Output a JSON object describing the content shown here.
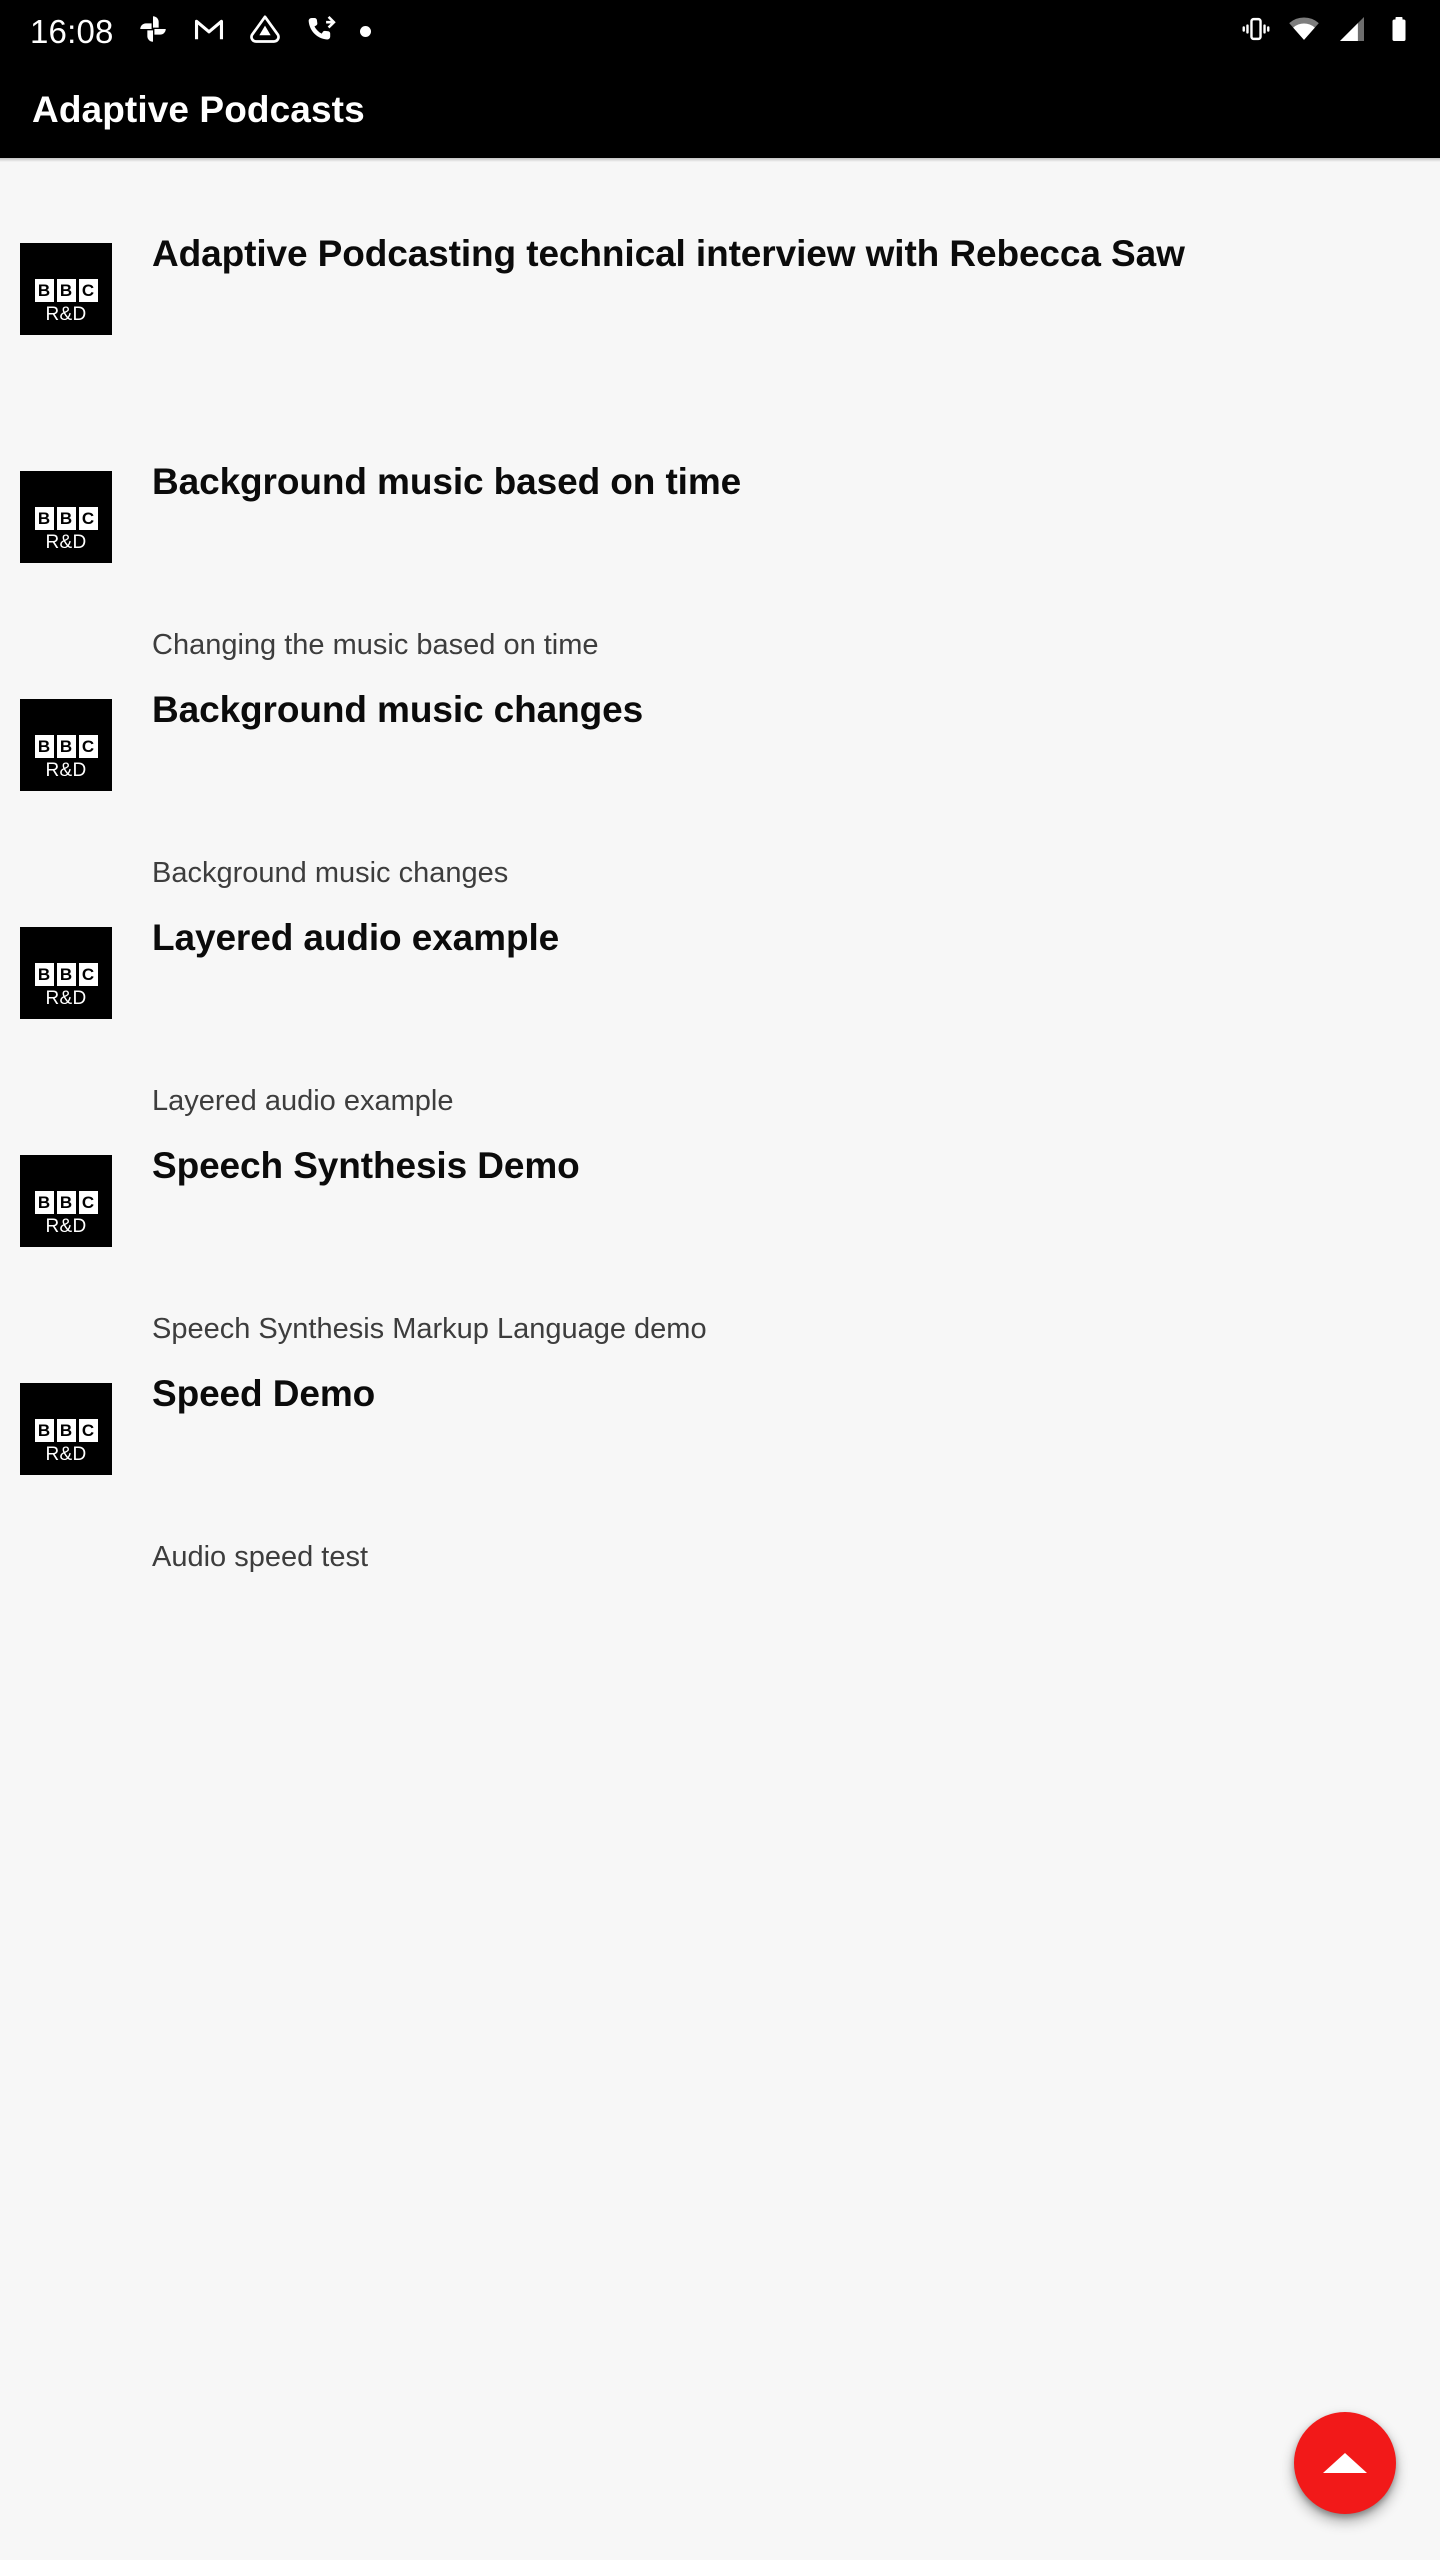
{
  "status_bar": {
    "time": "16:08",
    "left_icons": [
      "google-photos-icon",
      "gmail-icon",
      "drive-icon",
      "call-forward-icon",
      "dot-icon"
    ],
    "right_icons": [
      "vibrate-icon",
      "wifi-icon",
      "cellular-signal-icon",
      "battery-icon"
    ]
  },
  "app_bar": {
    "title": "Adaptive Podcasts"
  },
  "thumbnail": {
    "letters": [
      "B",
      "B",
      "C"
    ],
    "sub": "R&D"
  },
  "podcasts": [
    {
      "title": "Adaptive Podcasting technical interview with Rebecca Saw",
      "subtitle": ""
    },
    {
      "title": "Background music based on time",
      "subtitle": "Changing the music based on time"
    },
    {
      "title": "Background music changes",
      "subtitle": "Background music changes"
    },
    {
      "title": "Layered audio example",
      "subtitle": "Layered audio example"
    },
    {
      "title": "Speech Synthesis Demo",
      "subtitle": "Speech Synthesis Markup Language demo"
    },
    {
      "title": "Speed Demo",
      "subtitle": "Audio speed test"
    }
  ],
  "fab": {
    "icon": "triangle-up-icon",
    "color": "#f21919"
  },
  "colors": {
    "app_bar_bg": "#000000",
    "page_bg": "#f7f7f7",
    "title_text": "#0b0b0b",
    "subtitle_text": "#3d3d3d",
    "accent": "#f21919"
  }
}
